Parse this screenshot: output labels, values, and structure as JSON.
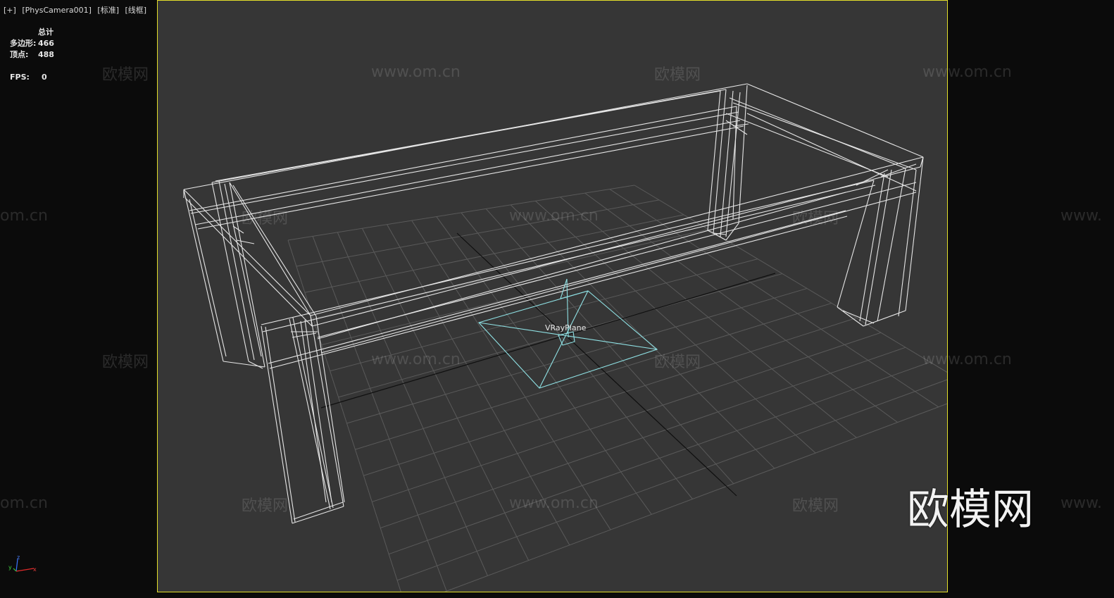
{
  "viewport": {
    "menu_label": "[+]",
    "camera_label": "[PhysCamera001]",
    "shading_label": "[标准]",
    "display_label": "[线框]",
    "border_color": "#e3de2a",
    "background_color": "#363636"
  },
  "stats": {
    "total_header": "总计",
    "polygons_label": "多边形:",
    "polygons_value": "466",
    "vertices_label": "顶点:",
    "vertices_value": "488",
    "fps_label": "FPS:",
    "fps_value": "0"
  },
  "scene": {
    "object_label": "VRayPlane",
    "wire_color": "#e6e6e6",
    "selected_wire_color": "#8fe1e4"
  },
  "gizmo": {
    "z": "z",
    "y": "y",
    "x": "x"
  },
  "watermarks": {
    "site": "www.om.cn",
    "brand": "欧模网",
    "site_partial_left": "om.cn",
    "site_partial_right": "www.",
    "logo": "欧模网"
  }
}
